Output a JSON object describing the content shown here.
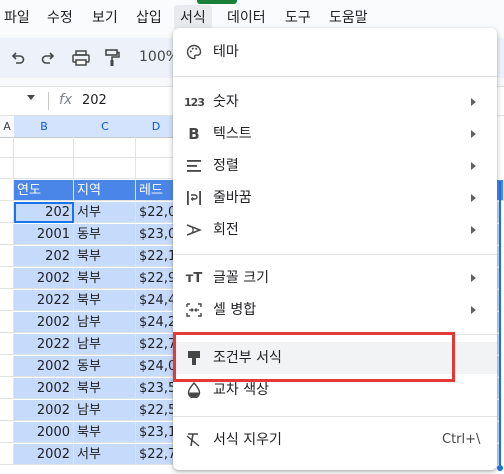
{
  "menubar": {
    "items": [
      "파일",
      "수정",
      "보기",
      "삽입",
      "서식",
      "데이터",
      "도구",
      "도움말"
    ],
    "active": "서식"
  },
  "toolbar": {
    "icons": [
      "undo-icon",
      "redo-icon",
      "print-icon",
      "paint-format-icon"
    ],
    "zoom": "100%"
  },
  "formula_bar": {
    "fx_label": "fx",
    "value": "202"
  },
  "grid": {
    "columns": [
      "A",
      "B",
      "C",
      "D"
    ],
    "header_row": [
      "연도",
      "지역",
      "레드"
    ],
    "rows": [
      [
        "202",
        "서부",
        "$22,0"
      ],
      [
        "2001",
        "동부",
        "$23,0"
      ],
      [
        "202",
        "북부",
        "$22,1"
      ],
      [
        "2002",
        "북부",
        "$22,9"
      ],
      [
        "2022",
        "북부",
        "$24,4"
      ],
      [
        "2002",
        "남부",
        "$24,2"
      ],
      [
        "2022",
        "남부",
        "$22,7"
      ],
      [
        "2002",
        "동부",
        "$24,0"
      ],
      [
        "2002",
        "북부",
        "$23,5"
      ],
      [
        "2002",
        "남부",
        "$22,5"
      ],
      [
        "2000",
        "북부",
        "$23,1"
      ],
      [
        "2002",
        "서부",
        "$22,7"
      ]
    ]
  },
  "format_menu": {
    "items": [
      {
        "label": "테마",
        "icon": "palette-icon",
        "submenu": false
      },
      {
        "label": "숫자",
        "icon": "number-format-icon",
        "submenu": true
      },
      {
        "label": "텍스트",
        "icon": "bold-icon",
        "submenu": true
      },
      {
        "label": "정렬",
        "icon": "align-icon",
        "submenu": true
      },
      {
        "label": "줄바꿈",
        "icon": "wrap-icon",
        "submenu": true
      },
      {
        "label": "회전",
        "icon": "rotate-icon",
        "submenu": true
      },
      {
        "label": "글꼴 크기",
        "icon": "font-size-icon",
        "submenu": true
      },
      {
        "label": "셀 병합",
        "icon": "merge-icon",
        "submenu": true
      },
      {
        "label": "조건부 서식",
        "icon": "paint-roller-icon",
        "submenu": false
      },
      {
        "label": "교차 색상",
        "icon": "fill-drop-icon",
        "submenu": false
      },
      {
        "label": "서식 지우기",
        "icon": "clear-format-icon",
        "submenu": false,
        "shortcut": "Ctrl+\\"
      }
    ],
    "highlighted": "조건부 서식"
  },
  "colors": {
    "header_fill": "#4a86e8",
    "selection_fill": "#c6dafc",
    "highlight_box": "#e53935",
    "active_menu_bar": "#188038"
  }
}
